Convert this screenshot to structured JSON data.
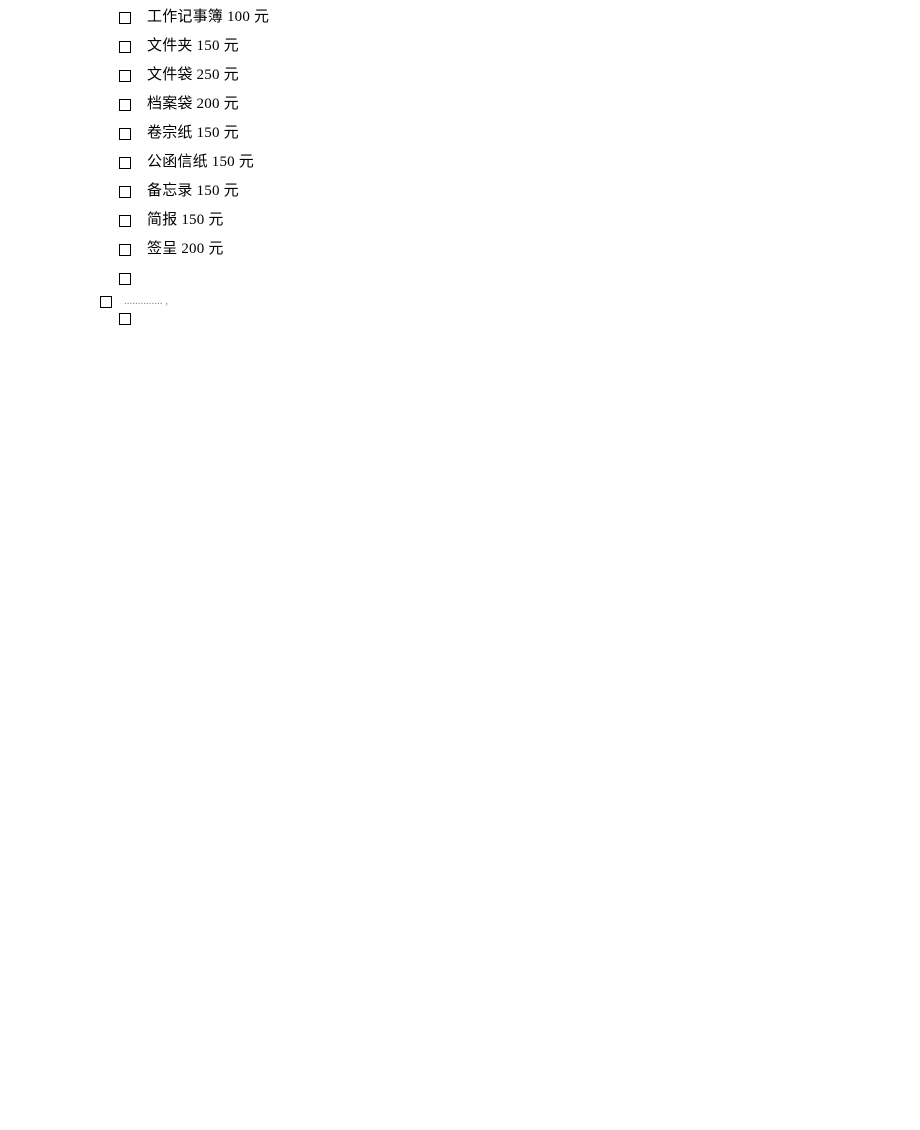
{
  "items": [
    {
      "label": "工作记事簿 100 元"
    },
    {
      "label": "文件夹 150 元"
    },
    {
      "label": "文件袋 250 元"
    },
    {
      "label": "档案袋 200 元"
    },
    {
      "label": "卷宗纸 150 元"
    },
    {
      "label": "公函信纸 150 元"
    },
    {
      "label": "备忘录 150 元"
    },
    {
      "label": "简报 150 元"
    },
    {
      "label": "签呈 200 元"
    },
    {
      "label": ""
    }
  ],
  "outer": {
    "dots": ".............. ,"
  }
}
